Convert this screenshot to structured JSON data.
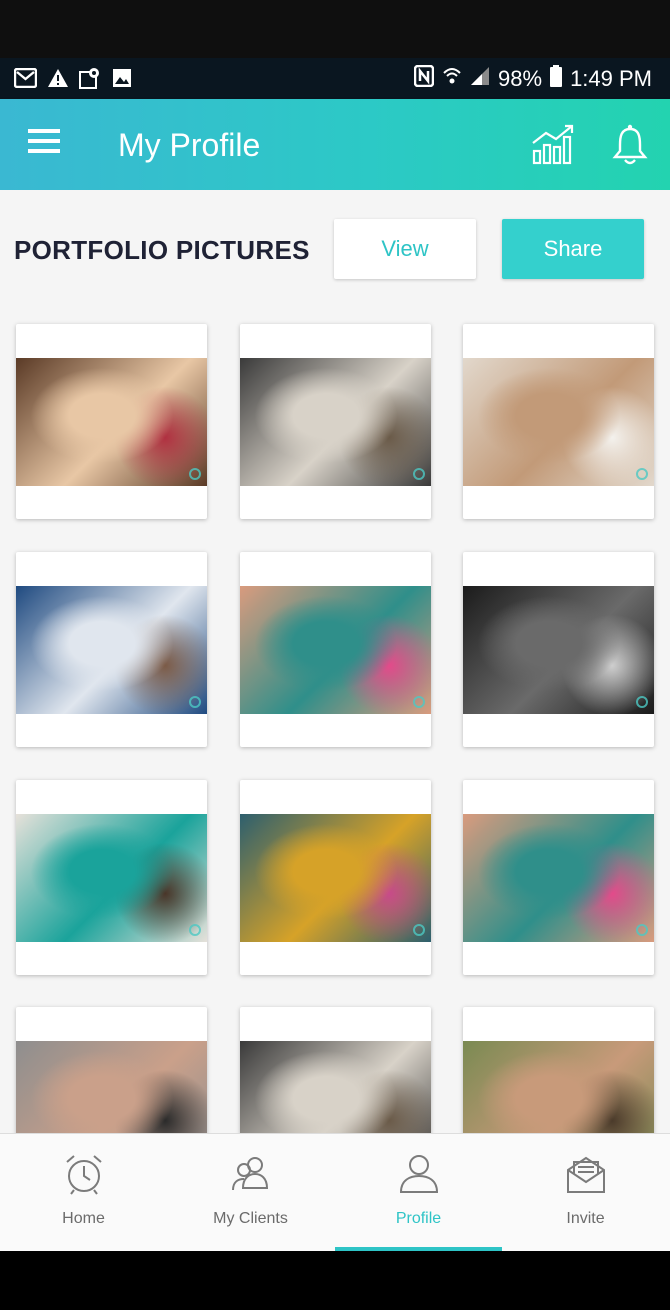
{
  "status_bar": {
    "battery": "98%",
    "time": "1:49 PM",
    "icons": [
      "gmail-icon",
      "alert-icon",
      "maps-icon",
      "gallery-icon",
      "nfc-icon",
      "wifi-icon",
      "signal-icon",
      "battery-icon"
    ]
  },
  "app_bar": {
    "title": "My Profile",
    "icons": [
      "menu-icon",
      "bar-chart-icon",
      "bell-icon"
    ]
  },
  "portfolio": {
    "heading": "PORTFOLIO PICTURES",
    "view_label": "View",
    "share_label": "Share",
    "photos": [
      {
        "subject": "woman with windblown hair smiling",
        "colors": [
          "#5a3a26",
          "#e8c7a5",
          "#b03040"
        ]
      },
      {
        "subject": "woman seated on beach under palm hut",
        "colors": [
          "#3a3a3a",
          "#d8d2c8",
          "#6a5a48"
        ]
      },
      {
        "subject": "woman reclining on sandy beach",
        "colors": [
          "#e2d8cc",
          "#c29a78",
          "#f4f2ee"
        ]
      },
      {
        "subject": "bearded man by the sea",
        "colors": [
          "#1f4a80",
          "#e0e6ee",
          "#7b5a46"
        ]
      },
      {
        "subject": "woman with teal hair and ice cream cone",
        "colors": [
          "#d99b7e",
          "#2f8f8a",
          "#e44a8a"
        ]
      },
      {
        "subject": "woman at piano in black and white",
        "colors": [
          "#1b1b1b",
          "#6a6a6a",
          "#cfcfcf"
        ]
      },
      {
        "subject": "woman in teal floral dress",
        "colors": [
          "#e6e1da",
          "#1aa39b",
          "#4a3528"
        ]
      },
      {
        "subject": "woman with colorful face paint",
        "colors": [
          "#2d5f6e",
          "#d6a228",
          "#c84a8a"
        ]
      },
      {
        "subject": "woman with teal hair and ice cream cone",
        "colors": [
          "#d99b7e",
          "#2f8f8a",
          "#e44a8a"
        ]
      },
      {
        "subject": "woman with dark makeup hand on face",
        "colors": [
          "#8e8e8e",
          "#caa08a",
          "#2a2a2a"
        ]
      },
      {
        "subject": "woman seated on beach under palm hut",
        "colors": [
          "#3a3a3a",
          "#d8d2c8",
          "#6a5a48"
        ]
      },
      {
        "subject": "woman with back tattoo outdoors",
        "colors": [
          "#7a8a52",
          "#c89a7a",
          "#4a3a2a"
        ]
      }
    ]
  },
  "bottom_nav": {
    "items": [
      {
        "label": "Home",
        "icon": "alarm-clock-icon",
        "active": false
      },
      {
        "label": "My Clients",
        "icon": "users-icon",
        "active": false
      },
      {
        "label": "Profile",
        "icon": "user-icon",
        "active": true
      },
      {
        "label": "Invite",
        "icon": "envelope-icon",
        "active": false
      }
    ]
  },
  "colors": {
    "accent": "#2ec4c6",
    "header_gradient_start": "#3ab8d2",
    "header_gradient_end": "#23d3b0",
    "heading_text": "#1f2235"
  }
}
